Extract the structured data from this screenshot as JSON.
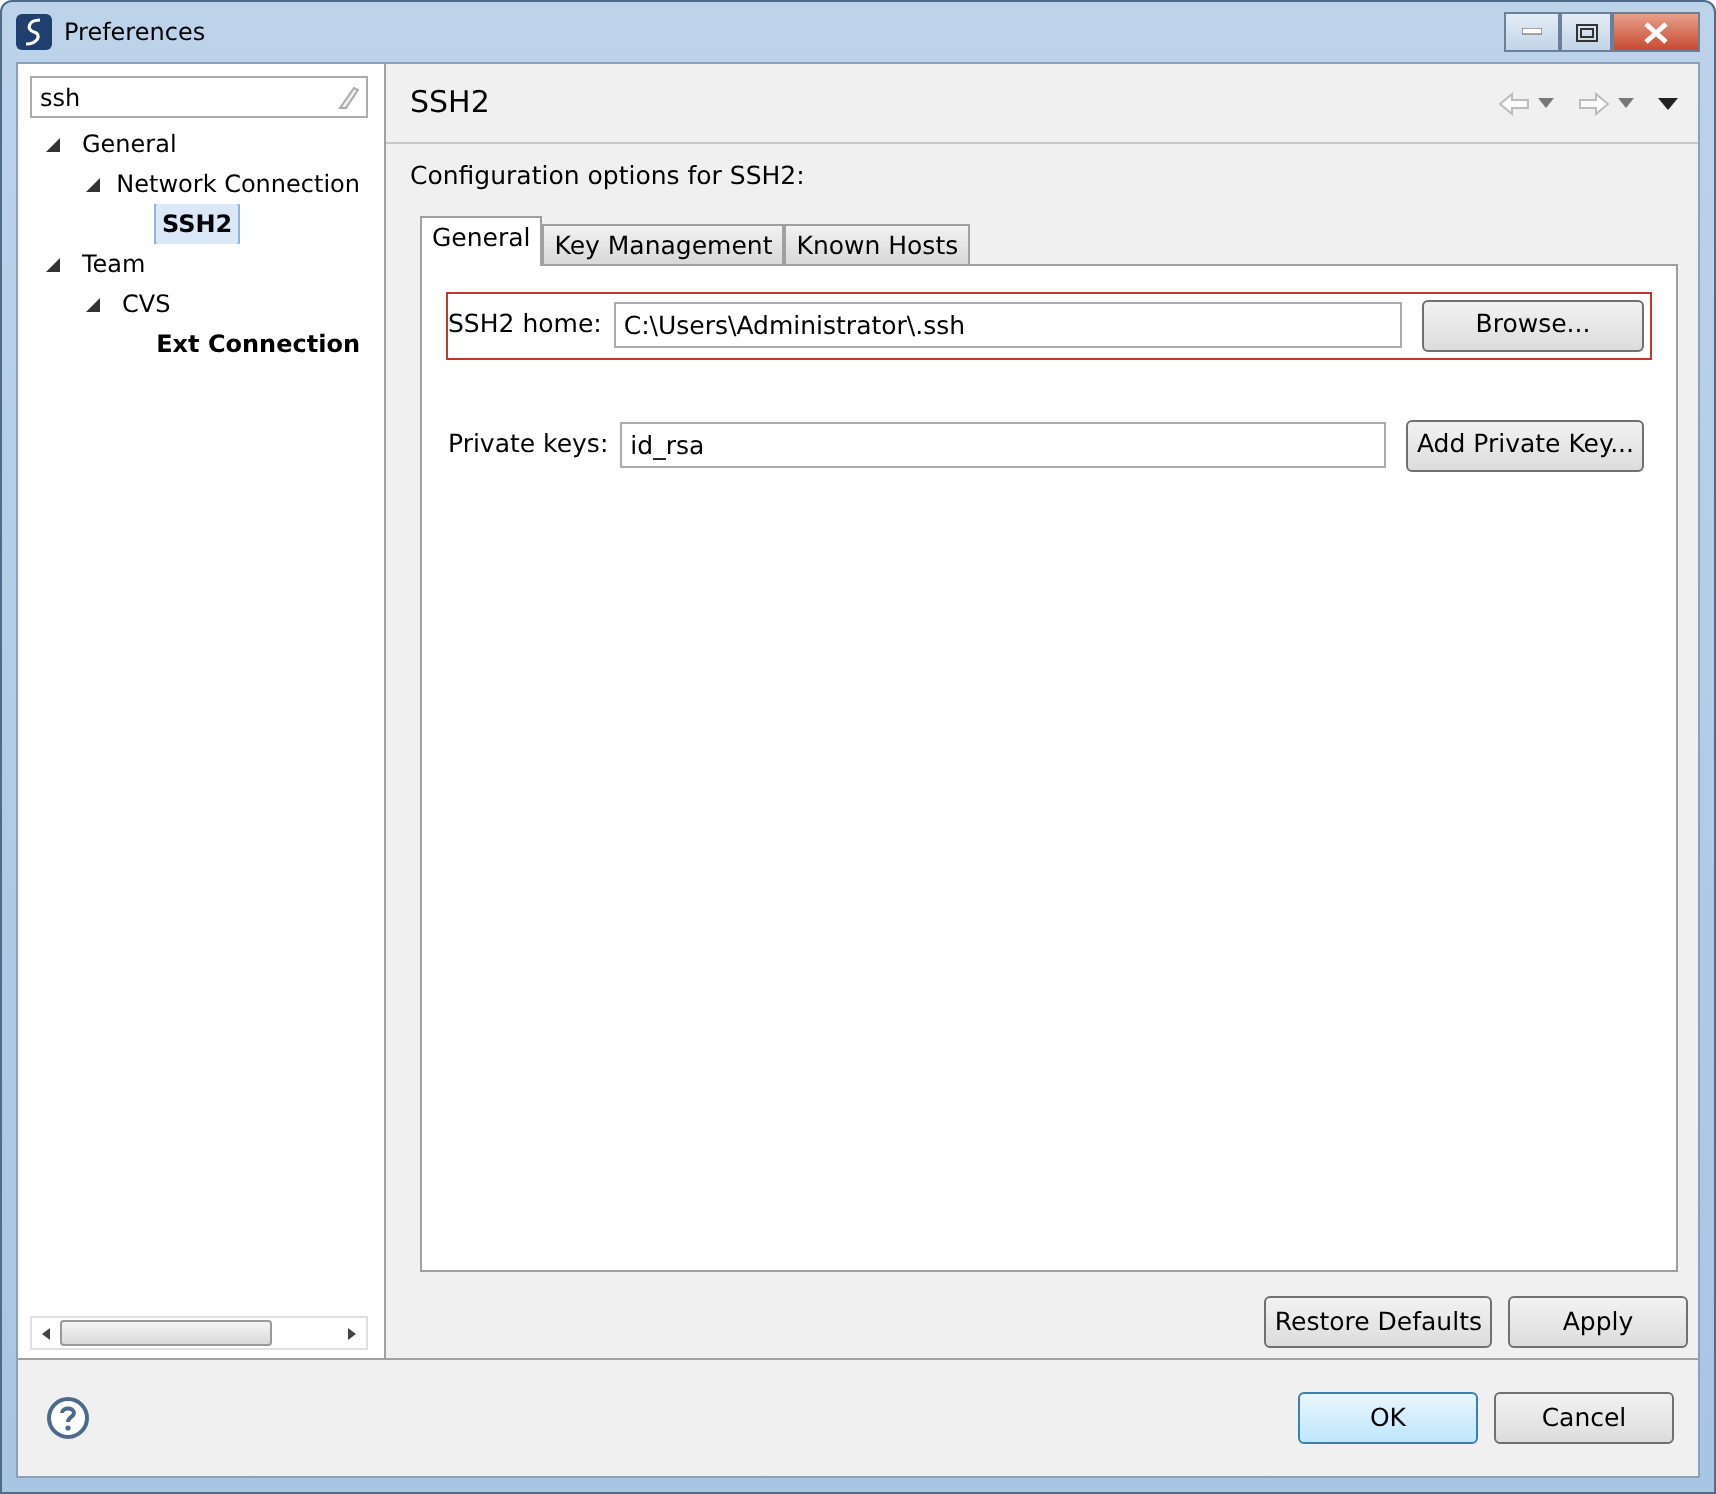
{
  "window": {
    "title": "Preferences"
  },
  "filter": {
    "value": "ssh"
  },
  "tree": [
    {
      "label": "General",
      "expanded": true,
      "selected": false,
      "bold": false,
      "children": [
        {
          "label": "Network Connection",
          "expanded": true,
          "selected": false,
          "bold": false,
          "children": [
            {
              "label": "SSH2",
              "selected": true,
              "bold": true
            }
          ]
        }
      ]
    },
    {
      "label": "Team",
      "expanded": true,
      "selected": false,
      "bold": false,
      "children": [
        {
          "label": "CVS",
          "expanded": true,
          "selected": false,
          "bold": false,
          "children": [
            {
              "label": "Ext Connection",
              "selected": false,
              "bold": true
            }
          ]
        }
      ]
    }
  ],
  "page": {
    "title": "SSH2",
    "description": "Configuration options for SSH2:"
  },
  "tabs": [
    {
      "label": "General",
      "selected": true
    },
    {
      "label": "Key Management",
      "selected": false
    },
    {
      "label": "Known Hosts",
      "selected": false
    }
  ],
  "fields": [
    {
      "label": "SSH2 home:",
      "value": "C:\\Users\\Administrator\\.ssh",
      "button": "Browse...",
      "highlighted": true
    },
    {
      "label": "Private keys:",
      "value": "id_rsa",
      "button": "Add Private Key...",
      "highlighted": false
    }
  ],
  "page_buttons": [
    "Restore Defaults",
    "Apply"
  ],
  "dialog_buttons": [
    {
      "label": "OK",
      "default": true
    },
    {
      "label": "Cancel",
      "default": false
    }
  ]
}
